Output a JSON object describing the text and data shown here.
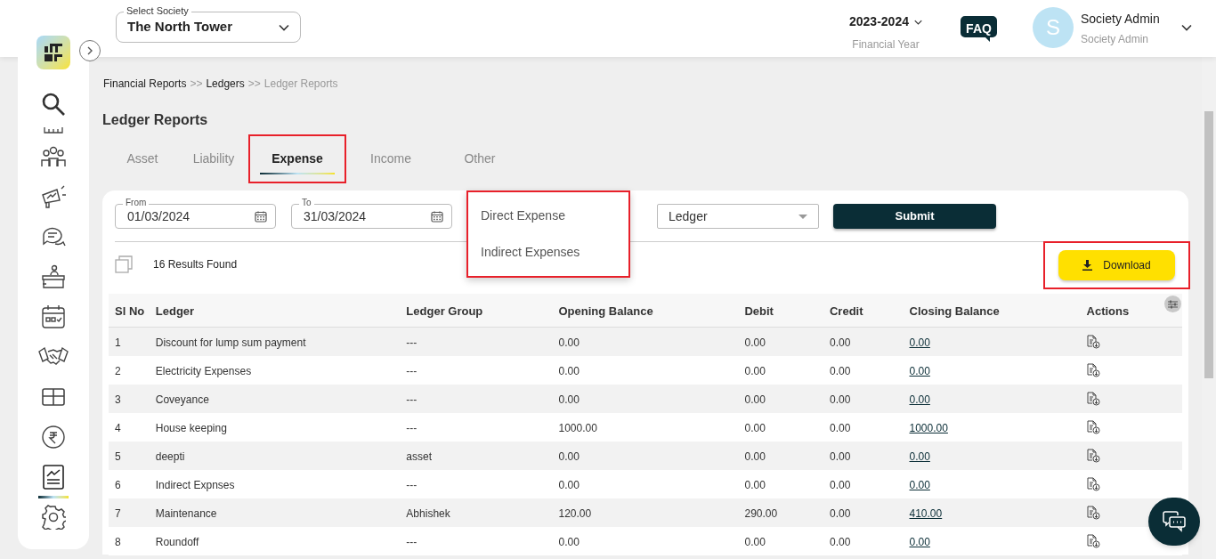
{
  "header": {
    "society_select": {
      "label": "Select Society",
      "value": "The North Tower"
    },
    "year": {
      "value": "2023-2024",
      "caption": "Financial Year"
    },
    "faq": "FAQ",
    "user": {
      "initial": "S",
      "name": "Society Admin",
      "role": "Society Admin"
    }
  },
  "sidebar": {
    "items": [
      {
        "selected": false
      },
      {
        "selected": false
      },
      {
        "selected": false
      },
      {
        "selected": false
      },
      {
        "selected": false
      },
      {
        "selected": false
      },
      {
        "selected": false
      },
      {
        "selected": false
      },
      {
        "selected": false
      },
      {
        "selected": false
      },
      {
        "selected": true
      },
      {
        "selected": false
      }
    ]
  },
  "breadcrumb": [
    {
      "label": "Financial Reports",
      "current": false
    },
    {
      "label": "Ledgers",
      "current": false
    },
    {
      "label": "Ledger Reports",
      "current": true
    }
  ],
  "breadcrumb_separator": ">>",
  "title": "Ledger Reports",
  "tabs": [
    {
      "label": "Asset",
      "selected": false,
      "highlighted": false
    },
    {
      "label": "Liability",
      "selected": false,
      "highlighted": false
    },
    {
      "label": "Expense",
      "selected": true,
      "highlighted": true
    },
    {
      "label": "Income",
      "selected": false,
      "highlighted": false
    },
    {
      "label": "Other",
      "selected": false,
      "highlighted": false
    }
  ],
  "filters": {
    "from": {
      "label": "From",
      "value": "01/03/2024"
    },
    "to": {
      "label": "To",
      "value": "31/03/2024"
    },
    "group_menu": {
      "highlighted": true,
      "options": [
        "Direct Expense",
        "Indirect Expenses"
      ]
    },
    "ledger_select": {
      "value": "Ledger"
    },
    "submit": "Submit"
  },
  "results": {
    "count": "16",
    "text": "Results Found"
  },
  "download": {
    "label": "Download",
    "highlighted": true
  },
  "table": {
    "columns": [
      "Sl No",
      "Ledger",
      "Ledger Group",
      "Opening Balance",
      "Debit",
      "Credit",
      "Closing Balance",
      "Actions"
    ],
    "rows": [
      [
        "1",
        "Discount for lump sum payment",
        "---",
        "0.00",
        "0.00",
        "0.00",
        "0.00"
      ],
      [
        "2",
        "Electricity Expenses",
        "---",
        "0.00",
        "0.00",
        "0.00",
        "0.00"
      ],
      [
        "3",
        "Coveyance",
        "---",
        "0.00",
        "0.00",
        "0.00",
        "0.00"
      ],
      [
        "4",
        "House keeping",
        "---",
        "1000.00",
        "0.00",
        "0.00",
        "1000.00"
      ],
      [
        "5",
        "deepti",
        "asset",
        "0.00",
        "0.00",
        "0.00",
        "0.00"
      ],
      [
        "6",
        "Indirect Expnses",
        "---",
        "0.00",
        "0.00",
        "0.00",
        "0.00"
      ],
      [
        "7",
        "Maintenance",
        "Abhishek",
        "120.00",
        "290.00",
        "0.00",
        "410.00"
      ],
      [
        "8",
        "Roundoff",
        "---",
        "0.00",
        "0.00",
        "0.00",
        "0.00"
      ]
    ]
  }
}
